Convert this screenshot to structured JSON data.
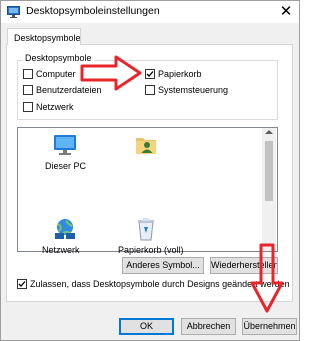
{
  "window": {
    "title": "Desktopsymboleinstellungen",
    "close_glyph": "✕"
  },
  "tabs": [
    {
      "label": "Desktopsymbole",
      "selected": true
    }
  ],
  "group": {
    "legend": "Desktopsymbole",
    "items": [
      {
        "label": "Computer",
        "checked": false
      },
      {
        "label": "Papierkorb",
        "checked": true
      },
      {
        "label": "Benutzerdateien",
        "checked": false
      },
      {
        "label": "Systemsteuerung",
        "checked": false
      },
      {
        "label": "Netzwerk",
        "checked": false
      }
    ]
  },
  "icons": [
    {
      "label": "Dieser PC",
      "icon": "computer-icon"
    },
    {
      "label": "",
      "icon": "user-folder-icon"
    },
    {
      "label": "Netzwerk",
      "icon": "network-icon"
    },
    {
      "label": "Papierkorb (voll)",
      "icon": "recycle-bin-full-icon"
    }
  ],
  "buttons": {
    "change_icon": "Anderes Symbol...",
    "restore_default": "Wiederherstellen",
    "ok": "OK",
    "cancel": "Abbrechen",
    "apply": "Übernehmen"
  },
  "themes_checkbox": {
    "label": "Zulassen, dass Desktopsymbole durch Designs geändert werden",
    "checked": true
  },
  "colors": {
    "arrow_red": "#e8252a",
    "accent": "#0078d7"
  }
}
